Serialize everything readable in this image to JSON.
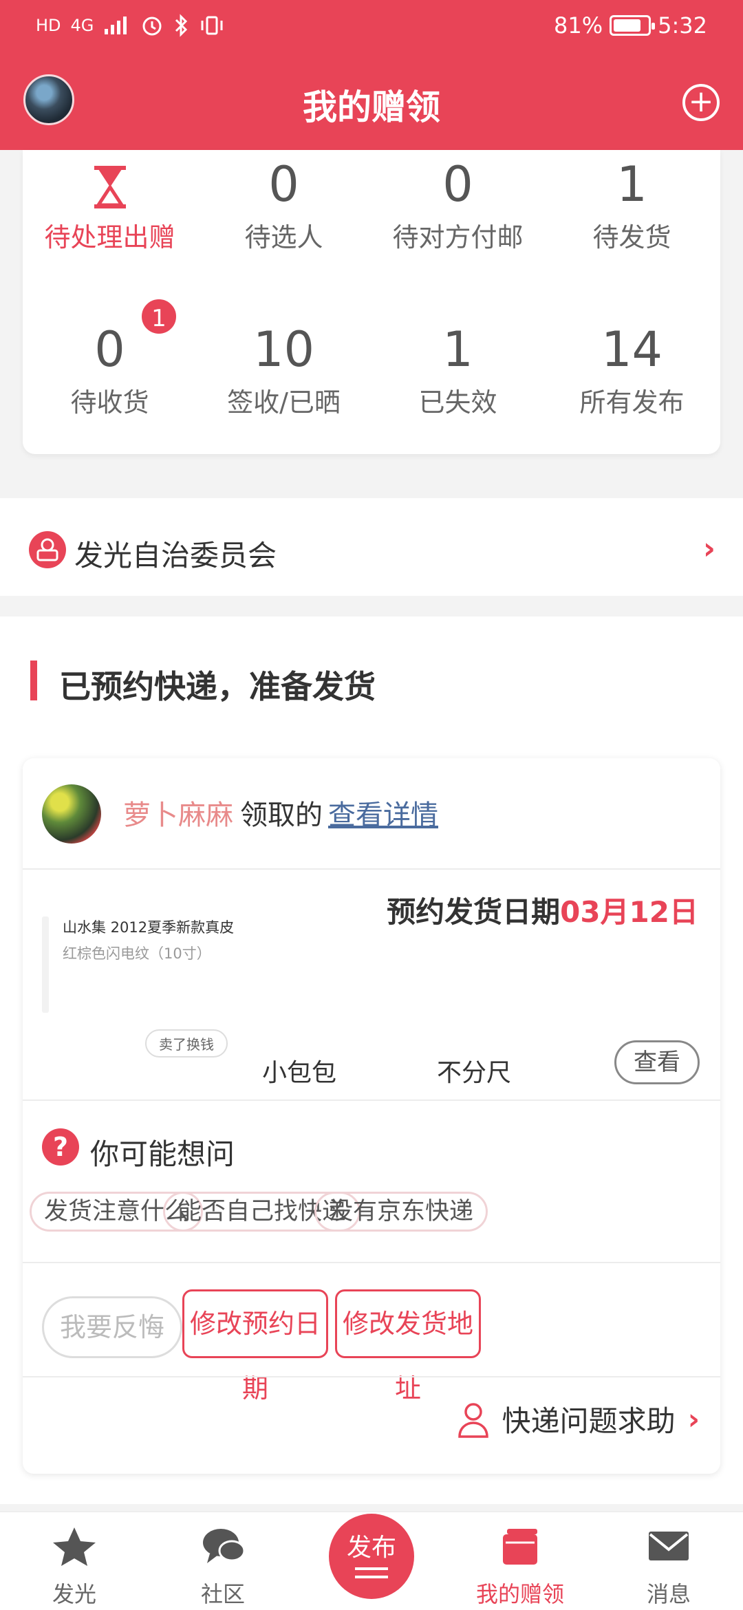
{
  "status_bar": {
    "icons": [
      "HD",
      "4G",
      "signal",
      "alarm",
      "bluetooth",
      "vibrate"
    ],
    "battery": "81%",
    "battery_level": 0.81,
    "time": "5:32"
  },
  "header": {
    "title": "我的赠领"
  },
  "stats": [
    {
      "value": "",
      "label": "待处理出赠",
      "badge": "1",
      "icon": "hourglass-icon",
      "active": true
    },
    {
      "value": "0",
      "label": "待选人"
    },
    {
      "value": "0",
      "label": "待对方付邮"
    },
    {
      "value": "1",
      "label": "待发货"
    },
    {
      "value": "0",
      "label": "待收货"
    },
    {
      "value": "10",
      "label": "签收/已晒"
    },
    {
      "value": "1",
      "label": "已失效"
    },
    {
      "value": "14",
      "label": "所有发布"
    }
  ],
  "committee": {
    "label": "发光自治委员会"
  },
  "section": {
    "title": "已预约快递，准备发货"
  },
  "order": {
    "buyer_name": "萝卜麻麻",
    "buyer_verb": "领取的",
    "detail_link": "查看详情",
    "thumb_title": "山水集 2012夏季新款真皮",
    "thumb_sub": "红棕色闪电纹（10寸）",
    "sold_tag": "卖了换钱",
    "ship_date_label": "预约发货日期",
    "ship_date": "03月12日",
    "spec1": "小包包",
    "spec2": "不分尺",
    "view_button": "查看"
  },
  "faq": {
    "icon_text": "?",
    "title": "你可能想问",
    "chips": [
      "发货注意什么",
      "能否自己找快递",
      "没有京东快递"
    ]
  },
  "actions": {
    "regret": "我要反悔",
    "change_date": "修改预约日期",
    "change_address": "修改发货地址"
  },
  "help": {
    "label": "快递问题求助"
  },
  "nav": {
    "items": [
      {
        "label": "发光",
        "icon": "star-icon"
      },
      {
        "label": "社区",
        "icon": "chat-icon"
      },
      {
        "label": "我的赠领",
        "icon": "gift-icon",
        "active": true
      },
      {
        "label": "消息",
        "icon": "mail-icon"
      }
    ],
    "publish": "发布"
  },
  "colors": {
    "accent": "#e84457",
    "background": "#f3f3f3"
  }
}
